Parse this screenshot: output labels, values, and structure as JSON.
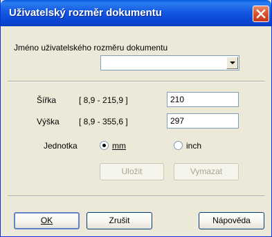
{
  "window": {
    "title": "Uživatelský rozměr dokumentu"
  },
  "name_section": {
    "label": "Jméno uživatelského rozměru dokumentu",
    "combo_value": ""
  },
  "size": {
    "width_label": "Šířka",
    "width_range": "[ 8,9 -  215,9 ]",
    "width_value": "210",
    "height_label": "Výška",
    "height_range": "[ 8,9 -  355,6 ]",
    "height_value": "297"
  },
  "unit": {
    "label": "Jednotka",
    "options": [
      {
        "label": "mm",
        "selected": true
      },
      {
        "label": "inch",
        "selected": false
      }
    ]
  },
  "buttons": {
    "save": "Uložit",
    "delete": "Vymazat",
    "ok": "OK",
    "cancel": "Zrušit",
    "help": "Nápověda"
  },
  "icons": {
    "close": "close-icon",
    "dropdown": "chevron-down-icon"
  }
}
